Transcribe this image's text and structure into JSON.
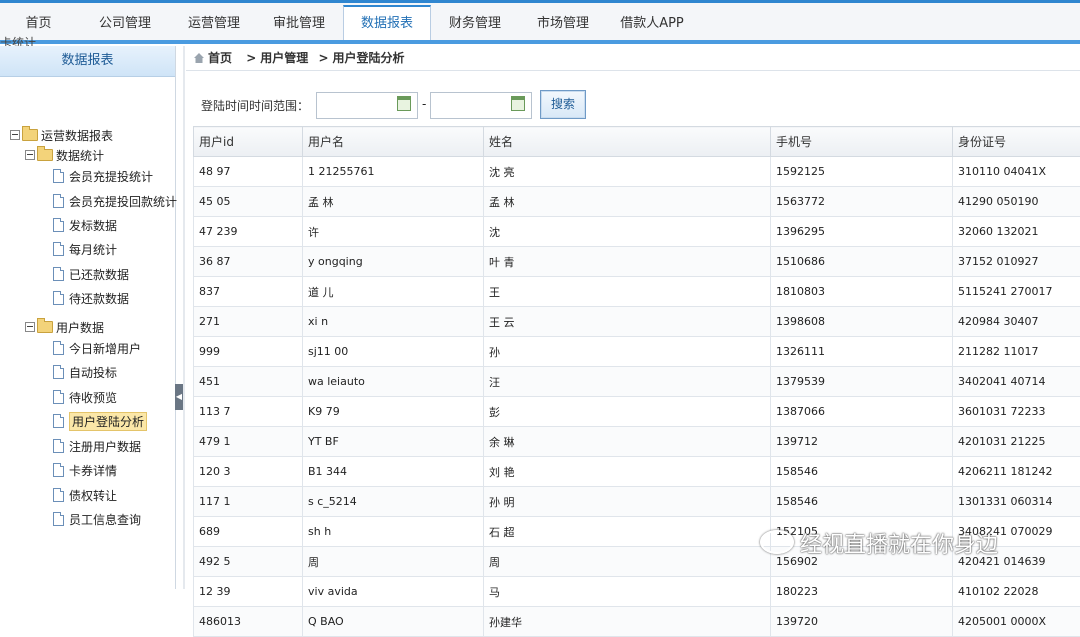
{
  "nav": {
    "tabs": [
      "首页",
      "公司管理",
      "运营管理",
      "审批管理",
      "数据报表",
      "财务管理",
      "市场管理",
      "借款人APP"
    ],
    "active_index": 4
  },
  "sidebar": {
    "header": "数据报表",
    "tree": {
      "root": "运营数据报表",
      "group1": {
        "label": "数据统计",
        "items": [
          "会员充提投统计",
          "会员充提投回款统计",
          "发标数据",
          "每月统计",
          "已还款数据",
          "待还款数据"
        ]
      },
      "group2": {
        "label": "用户数据",
        "items": [
          "今日新增用户",
          "自动投标",
          "待收预览",
          "用户登陆分析",
          "注册用户数据",
          "卡券详情",
          "债权转让",
          "员工信息查询"
        ]
      },
      "selected": "用户登陆分析"
    }
  },
  "breadcrumb": {
    "home": "首页",
    "level1": "用户管理",
    "level2": "用户登陆分析"
  },
  "filter": {
    "label": "登陆时间时间范围：",
    "separator": "-",
    "search_button": "搜索",
    "start_value": "",
    "end_value": ""
  },
  "table": {
    "columns": [
      "用户id",
      "用户名",
      "姓名",
      "手机号",
      "身份证号"
    ],
    "rows": [
      [
        "48  97",
        "1  21255761",
        "沈  亮",
        "1592125",
        "310110  04041X"
      ],
      [
        "45  05",
        "孟  林",
        "孟  林",
        "1563772",
        "41290  050190"
      ],
      [
        "47  239",
        "许  ",
        "沈  ",
        "1396295",
        "32060  132021"
      ],
      [
        "36  87",
        "y  ongqing",
        "叶  青",
        "1510686",
        "37152  010927"
      ],
      [
        "837",
        "道  儿",
        "王  ",
        "1810803",
        "5115241  270017"
      ],
      [
        "271",
        "xi  n",
        "王  云",
        "1398608",
        "420984  30407"
      ],
      [
        "999",
        "sj11  00",
        "孙  ",
        "1326111",
        "211282  11017"
      ],
      [
        "451",
        "wa  leiauto",
        "汪  ",
        "1379539",
        "3402041  40714"
      ],
      [
        "113  7",
        "K9  79",
        "彭  ",
        "1387066",
        "3601031  72233"
      ],
      [
        "479  1",
        "YT  BF",
        "余  琳",
        "139712",
        "4201031  21225"
      ],
      [
        "120  3",
        "B1  344",
        "刘  艳",
        "158546",
        "4206211  181242"
      ],
      [
        "117  1",
        "s  c_5214",
        "孙  明",
        "158546",
        "1301331  060314"
      ],
      [
        "689",
        "sh  h",
        "石  超",
        "152105",
        "3408241  070029"
      ],
      [
        "492  5",
        "周  ",
        "周  ",
        "156902",
        "420421  014639"
      ],
      [
        "12  39",
        "viv  avida",
        "马  ",
        "180223",
        "410102  22028"
      ],
      [
        "486013",
        "Q  BAO",
        "孙建华",
        "139720",
        "4205001  0000X"
      ]
    ]
  },
  "watermark": "经视直播就在你身边",
  "remnant_text": "卡统计"
}
